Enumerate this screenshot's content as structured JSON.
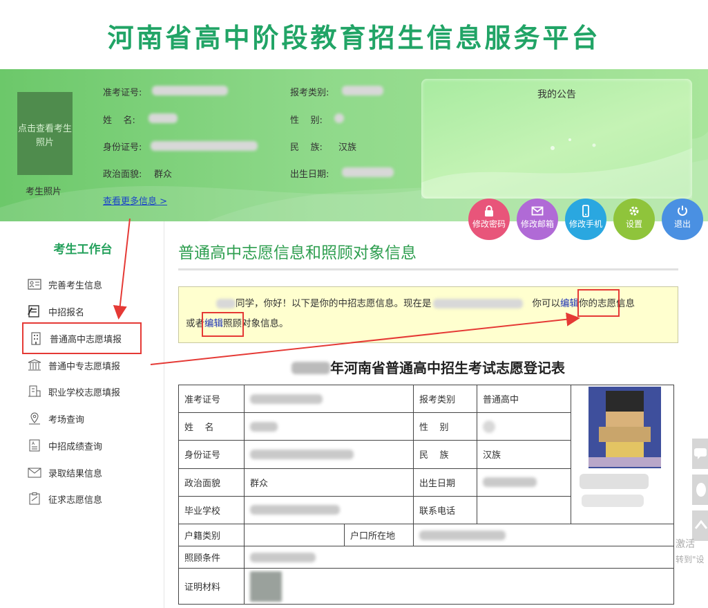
{
  "site_title": "河南省高中阶段教育招生信息服务平台",
  "profile": {
    "photo_prompt": "点击查看考生照片",
    "photo_caption": "考生照片",
    "exam_no_label": "准考证号:",
    "name_label": "姓    名:",
    "id_no_label": "身份证号:",
    "political_label": "政治面貌:",
    "political_value": "群众",
    "category_label": "报考类别:",
    "gender_label": "性    别:",
    "ethnic_label": "民    族:",
    "ethnic_value": "汉族",
    "birth_label": "出生日期:",
    "more_link": "查看更多信息 >"
  },
  "notice": {
    "title": "我的公告"
  },
  "actions": [
    {
      "label": "修改密码",
      "icon": "lock-icon",
      "color": "#e8557a"
    },
    {
      "label": "修改邮箱",
      "icon": "mail-icon",
      "color": "#b06ad6"
    },
    {
      "label": "修改手机",
      "icon": "phone-icon",
      "color": "#2aa7e0"
    },
    {
      "label": "设置",
      "icon": "gear-icon",
      "color": "#8fc43b"
    },
    {
      "label": "退出",
      "icon": "power-icon",
      "color": "#4a90e2"
    }
  ],
  "sidebar": {
    "title": "考生工作台",
    "items": [
      {
        "label": "完善考生信息",
        "icon": "id-card-icon"
      },
      {
        "label": "中招报名",
        "icon": "signup-icon"
      },
      {
        "label": "普通高中志愿填报",
        "icon": "school-building-icon"
      },
      {
        "label": "普通中专志愿填报",
        "icon": "institution-icon"
      },
      {
        "label": "职业学校志愿填报",
        "icon": "document-building-icon"
      },
      {
        "label": "考场查询",
        "icon": "location-pin-icon"
      },
      {
        "label": "中招成绩查询",
        "icon": "score-sheet-icon"
      },
      {
        "label": "录取结果信息",
        "icon": "envelope-icon"
      },
      {
        "label": "征求志愿信息",
        "icon": "clipboard-icon"
      }
    ]
  },
  "main": {
    "title": "普通高中志愿信息和照顾对象信息",
    "message": {
      "part1": "同学，你好！以下是你的中招志愿信息。现在是",
      "part2": "你可以",
      "link1": "编辑",
      "part3": "你的志愿信息",
      "part4": "或者",
      "link2": "编辑",
      "part5": "照顾对象信息。"
    },
    "form_title": "年河南省普通高中招生考试志愿登记表",
    "table": {
      "exam_no": "准考证号",
      "category": "报考类别",
      "category_value": "普通高中",
      "name": "姓    名",
      "gender": "性    别",
      "id_no": "身份证号",
      "ethnic": "民    族",
      "ethnic_value": "汉族",
      "political": "政治面貌",
      "political_value": "群众",
      "birth": "出生日期",
      "school": "毕业学校",
      "phone": "联系电话",
      "household_type": "户籍类别",
      "household_loc": "户口所在地",
      "care": "照顾条件",
      "proof": "证明材料"
    }
  },
  "watermark": {
    "line1": "激活",
    "line2": "转到\"设"
  }
}
